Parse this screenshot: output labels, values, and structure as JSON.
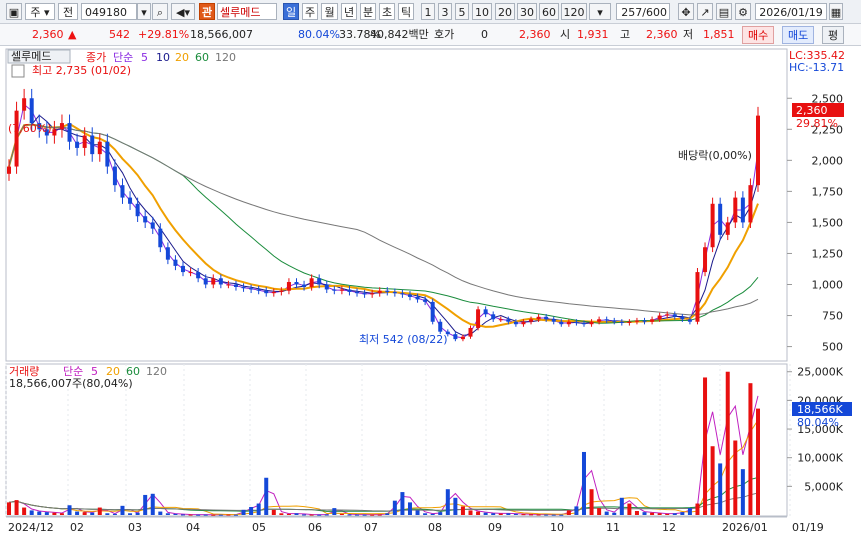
{
  "toolbar": {
    "market": "주",
    "type": "전",
    "code": "049180",
    "badge": "관",
    "name": "셀루메드",
    "periods": [
      "일",
      "주",
      "월",
      "년",
      "분",
      "초",
      "틱"
    ],
    "active_period": "일",
    "minutes": [
      "1",
      "3",
      "5",
      "10",
      "20",
      "30",
      "60",
      "120"
    ],
    "count": "257",
    "count_total": "/600",
    "date": "2026/01/19"
  },
  "quote": {
    "price": "2,360",
    "arrow": "▲",
    "change": "542",
    "pct": "+29.81%",
    "volume": "18,566,007",
    "vol_ratio": "80.04%",
    "turnover": "33.78%",
    "amount": "40,842백만",
    "hoga_label": "호가",
    "hoga_value": "0",
    "current": "2,360",
    "open_label": "시",
    "open": "1,931",
    "high_label": "고",
    "high": "2,360",
    "low_label": "저",
    "low": "1,851",
    "buy": "매수",
    "sell": "매도",
    "eval": "평"
  },
  "price_panel": {
    "legend_name": "셀루메드",
    "legend_close": "종가",
    "legend_ma": "단순",
    "ma_periods": [
      "5",
      "10",
      "20",
      "60",
      "120"
    ],
    "ma_colors": [
      "#8a2be2",
      "#1a1a8c",
      "#f0a000",
      "#1a8c3c",
      "#777777"
    ],
    "high_note": "최고 2,735 (01/02)",
    "low_note": "최저 542 (08/22)",
    "dividend_note": "배당락(0,00%)",
    "pct_left": "(7,60%)",
    "lc": "LC:335.42",
    "hc": "HC:-13.71",
    "last_price": "2,360",
    "last_pct": "29.81%",
    "up_color": "#e81010",
    "down_color": "#1448d8"
  },
  "volume_panel": {
    "legend_name": "거래량",
    "legend_ma": "단순",
    "ma_periods": [
      "5",
      "20",
      "60",
      "120"
    ],
    "ma_colors": [
      "#c020c0",
      "#f0a000",
      "#1a8c3c",
      "#777777"
    ],
    "value_note": "18,566,007주(80,04%)",
    "last_volume": "18,566K",
    "last_pct": "80.04%"
  },
  "x_axis": {
    "labels": [
      "2024/12",
      "02",
      "03",
      "04",
      "05",
      "06",
      "07",
      "08",
      "09",
      "10",
      "11",
      "12",
      "2026/01",
      "01/19"
    ]
  },
  "chart_data": [
    {
      "type": "candlestick",
      "title": "셀루메드",
      "ylim": [
        400,
        2800
      ],
      "y_ticks": [
        500,
        750,
        1000,
        1250,
        1500,
        1750,
        2000,
        2250,
        2500
      ],
      "y_tick_labels": [
        "500",
        "750",
        "1,000",
        "1,250",
        "1,500",
        "1,750",
        "2,000",
        "2,250",
        "2,500"
      ],
      "x_labels": [
        "2024/12",
        "02",
        "03",
        "04",
        "05",
        "06",
        "07",
        "08",
        "09",
        "10",
        "11",
        "12",
        "2026/01"
      ],
      "close_series": [
        1950,
        2400,
        2500,
        2300,
        2250,
        2200,
        2250,
        2300,
        2150,
        2100,
        2200,
        2050,
        2150,
        1950,
        1800,
        1700,
        1650,
        1550,
        1500,
        1450,
        1300,
        1200,
        1150,
        1100,
        1100,
        1050,
        1000,
        1050,
        1000,
        1000,
        980,
        970,
        960,
        950,
        930,
        940,
        950,
        1020,
        1000,
        980,
        1050,
        1000,
        960,
        950,
        960,
        940,
        930,
        920,
        930,
        950,
        940,
        930,
        920,
        900,
        880,
        860,
        700,
        620,
        600,
        560,
        580,
        650,
        800,
        760,
        720,
        720,
        700,
        680,
        700,
        720,
        740,
        720,
        700,
        680,
        700,
        690,
        680,
        700,
        720,
        710,
        700,
        690,
        700,
        710,
        700,
        720,
        750,
        760,
        740,
        720,
        700,
        1100,
        1300,
        1650,
        1400,
        1500,
        1700,
        1500,
        1800,
        2360
      ],
      "volume_series": [
        2200,
        2600,
        1300,
        800,
        600,
        500,
        400,
        300,
        1700,
        600,
        500,
        400,
        1300,
        300,
        200,
        1600,
        300,
        400,
        3500,
        3700,
        600,
        300,
        200,
        100,
        80,
        60,
        70,
        50,
        60,
        80,
        60,
        900,
        1400,
        2000,
        6500,
        900,
        300,
        200,
        300,
        100,
        80,
        60,
        100,
        1200,
        200,
        100,
        80,
        70,
        60,
        80,
        300,
        2500,
        4000,
        2200,
        800,
        300,
        200,
        500,
        4500,
        3000,
        1500,
        800,
        600,
        400,
        300,
        250,
        300,
        200,
        150,
        120,
        100,
        80,
        70,
        60,
        800,
        1500,
        11000,
        4500,
        1200,
        600,
        400,
        3000,
        2000,
        700,
        500,
        400,
        300,
        200,
        300,
        500,
        1200,
        2000,
        24000,
        12000,
        9000,
        25000,
        13000,
        8000,
        23000,
        18566
      ]
    },
    {
      "type": "bar",
      "title": "거래량",
      "ylim": [
        0,
        26000
      ],
      "y_ticks": [
        5000,
        10000,
        15000,
        20000,
        25000
      ],
      "y_tick_labels": [
        "5,000K",
        "10,000K",
        "15,000K",
        "20,000K",
        "25,000K"
      ]
    }
  ]
}
